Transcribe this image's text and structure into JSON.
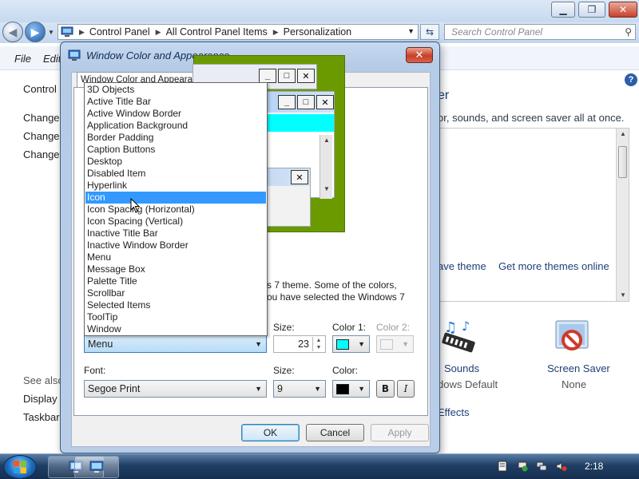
{
  "explorer": {
    "breadcrumbs": [
      "Control Panel",
      "All Control Panel Items",
      "Personalization"
    ],
    "search_placeholder": "Search Control Panel",
    "menu": [
      "File",
      "Edit"
    ],
    "left_links": [
      "Control Panel Home",
      "Change desktop icons",
      "Change mouse pointers",
      "Change your account picture"
    ],
    "left_links_visible": [
      "Control P",
      "Change d",
      "Change m",
      "Change y"
    ],
    "see_also": "See also",
    "see_also_links": [
      "Display",
      "Taskbar a"
    ],
    "heading_fragment": "er",
    "description_fragment": "or, sounds, and screen saver all at once.",
    "save_theme": "ave theme",
    "get_more_themes": "Get more themes online",
    "sounds": {
      "label": "Sounds",
      "sub": "dows Default"
    },
    "screen_saver": {
      "label": "Screen Saver",
      "sub": "None"
    },
    "effects_fragment": "Effects"
  },
  "dialog": {
    "title": "Window Color and Appearance",
    "tab_label": "Window Color and Appearance",
    "close_label": "✕",
    "description": [
      "s 7 theme.  Some of the colors,",
      "ou have selected the Windows 7"
    ],
    "item_label": "Item:",
    "item_value": "Menu",
    "size_label": "Size:",
    "size_value": "23",
    "color1_label": "Color 1:",
    "color1_hex": "#00ffff",
    "color2_label": "Color 2:",
    "font_label": "Font:",
    "font_value": "Segoe Print",
    "font_size_label": "Size:",
    "font_size_value": "9",
    "font_color_label": "Color:",
    "font_color_hex": "#000000",
    "bold_label": "B",
    "italic_label": "I",
    "ok": "OK",
    "cancel": "Cancel",
    "apply": "Apply",
    "dropdown_items": [
      "3D Objects",
      "Active Title Bar",
      "Active Window Border",
      "Application Background",
      "Border Padding",
      "Caption Buttons",
      "Desktop",
      "Disabled Item",
      "Hyperlink",
      "Icon",
      "Icon Spacing (Horizontal)",
      "Icon Spacing (Vertical)",
      "Inactive Title Bar",
      "Inactive Window Border",
      "Menu",
      "Message Box",
      "Palette Title",
      "Scrollbar",
      "Selected Items",
      "ToolTip",
      "Window"
    ],
    "dropdown_selected": "Icon"
  },
  "taskbar": {
    "clock": "2:18"
  },
  "colors": {
    "preview_desktop": "#6b9a00",
    "active_title": "#00ffff",
    "selection": "#3399ff"
  }
}
